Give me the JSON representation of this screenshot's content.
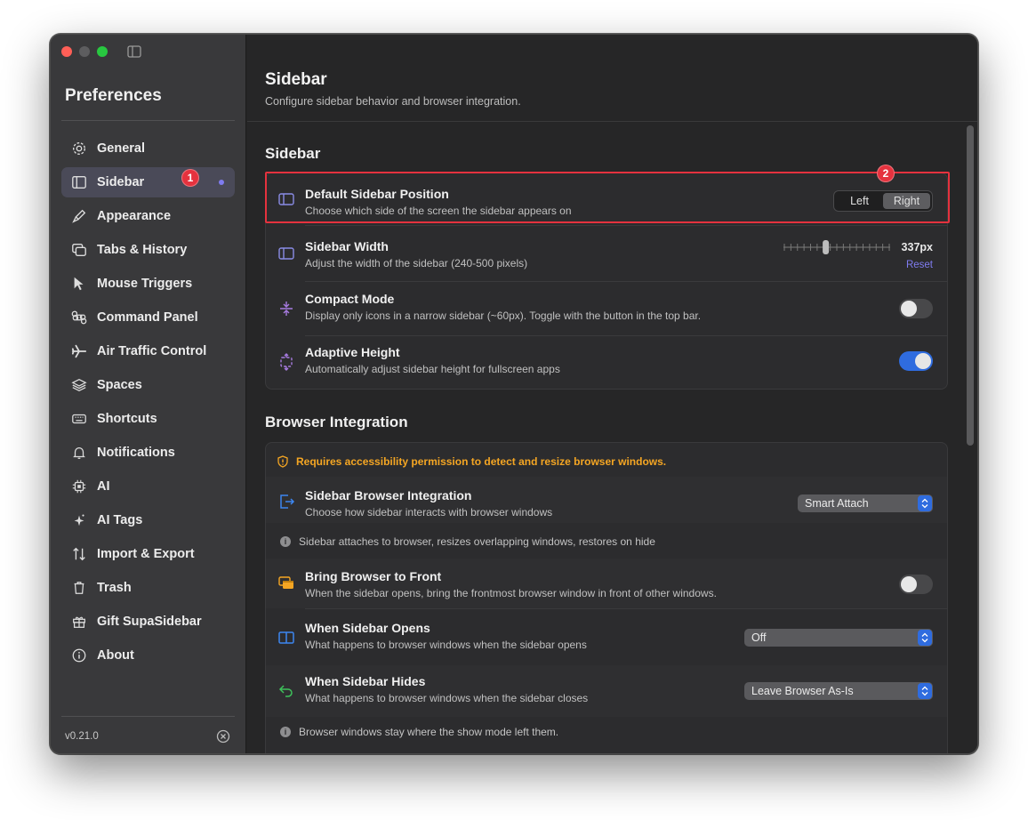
{
  "window": {
    "app_title": "Preferences",
    "version": "v0.21.0"
  },
  "sidebar": {
    "items": [
      {
        "label": "General",
        "icon": "gear-icon"
      },
      {
        "label": "Sidebar",
        "icon": "sidebar-icon",
        "active": true
      },
      {
        "label": "Appearance",
        "icon": "paintbrush-icon"
      },
      {
        "label": "Tabs & History",
        "icon": "tabs-icon"
      },
      {
        "label": "Mouse Triggers",
        "icon": "cursor-icon"
      },
      {
        "label": "Command Panel",
        "icon": "command-icon"
      },
      {
        "label": "Air Traffic Control",
        "icon": "airplane-icon"
      },
      {
        "label": "Spaces",
        "icon": "layers-icon"
      },
      {
        "label": "Shortcuts",
        "icon": "keyboard-icon"
      },
      {
        "label": "Notifications",
        "icon": "bell-icon"
      },
      {
        "label": "AI",
        "icon": "chip-icon"
      },
      {
        "label": "AI Tags",
        "icon": "sparkle-icon"
      },
      {
        "label": "Import & Export",
        "icon": "arrows-updown-icon"
      },
      {
        "label": "Trash",
        "icon": "trash-icon"
      },
      {
        "label": "Gift SupaSidebar",
        "icon": "gift-icon"
      },
      {
        "label": "About",
        "icon": "info-icon"
      }
    ]
  },
  "markers": {
    "m1": "1",
    "m2": "2"
  },
  "header": {
    "title": "Sidebar",
    "subtitle": "Configure sidebar behavior and browser integration."
  },
  "sidebar_section": {
    "title": "Sidebar",
    "default_position": {
      "title": "Default Sidebar Position",
      "desc": "Choose which side of the screen the sidebar appears on",
      "options": [
        "Left",
        "Right"
      ],
      "selected": "Right"
    },
    "width": {
      "title": "Sidebar Width",
      "desc": "Adjust the width of the sidebar (240-500 pixels)",
      "value_label": "337px",
      "value_fraction": 0.39,
      "reset_label": "Reset"
    },
    "compact": {
      "title": "Compact Mode",
      "desc": "Display only icons in a narrow sidebar (~60px). Toggle with the button in the top bar.",
      "on": false
    },
    "adaptive": {
      "title": "Adaptive Height",
      "desc": "Automatically adjust sidebar height for fullscreen apps",
      "on": true
    }
  },
  "browser_section": {
    "title": "Browser Integration",
    "warning": "Requires accessibility permission to detect and resize browser windows.",
    "integration": {
      "title": "Sidebar Browser Integration",
      "desc": "Choose how sidebar interacts with browser windows",
      "value": "Smart Attach"
    },
    "integration_info": "Sidebar attaches to browser, resizes overlapping windows, restores on hide",
    "bring_front": {
      "title": "Bring Browser to Front",
      "desc": "When the sidebar opens, bring the frontmost browser window in front of other windows.",
      "on": false
    },
    "opens": {
      "title": "When Sidebar Opens",
      "desc": "What happens to browser windows when the sidebar opens",
      "value": "Off"
    },
    "hides": {
      "title": "When Sidebar Hides",
      "desc": "What happens to browser windows when the sidebar closes",
      "value": "Leave Browser As-Is"
    },
    "hides_info": "Browser windows stay where the show mode left them."
  },
  "colors": {
    "accent": "#2f6cdf",
    "marker": "#e5323e",
    "warning": "#f5a623",
    "purple": "#7f7cf0"
  }
}
